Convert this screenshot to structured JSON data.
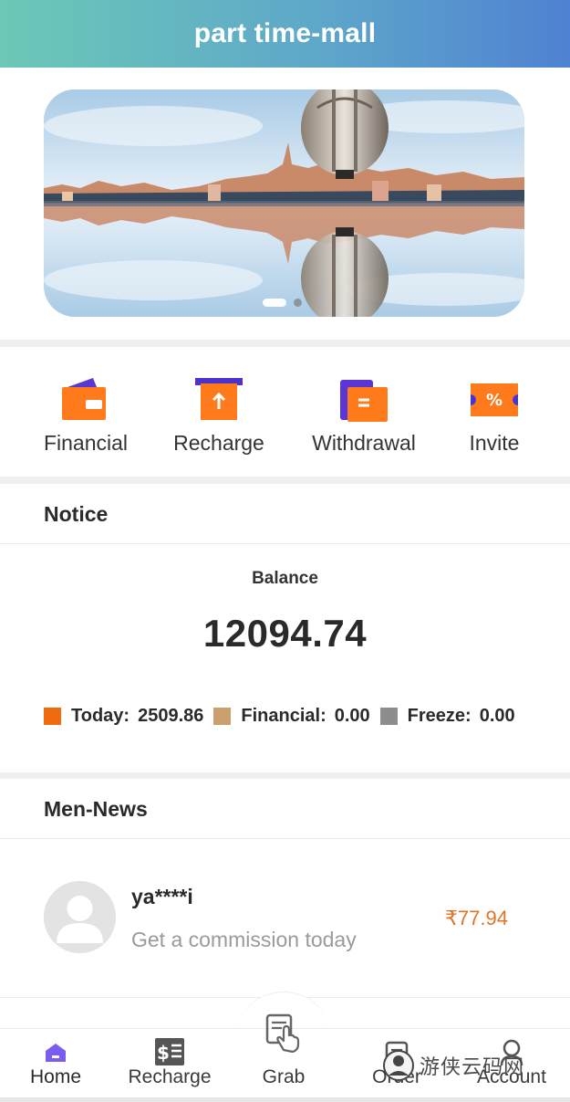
{
  "header": {
    "title": "part time-mall"
  },
  "quick_actions": [
    {
      "label": "Financial",
      "icon": "wallet-icon"
    },
    {
      "label": "Recharge",
      "icon": "recharge-icon"
    },
    {
      "label": "Withdrawal",
      "icon": "withdrawal-icon"
    },
    {
      "label": "Invite",
      "icon": "coupon-icon"
    }
  ],
  "notice": {
    "title": "Notice"
  },
  "balance": {
    "label": "Balance",
    "value": "12094.74",
    "stats": [
      {
        "label": "Today:",
        "value": "2509.86",
        "color": "#f06a10"
      },
      {
        "label": "Financial:",
        "value": "0.00",
        "color": "#c9a06e"
      },
      {
        "label": "Freeze:",
        "value": "0.00",
        "color": "#8d8d8d"
      }
    ]
  },
  "news": {
    "title": "Men-News",
    "items": [
      {
        "user": "ya****i",
        "description": "Get a commission today",
        "amount": "₹77.94"
      }
    ]
  },
  "tabbar": {
    "items": [
      {
        "label": "Home",
        "icon": "home-icon",
        "active": true
      },
      {
        "label": "Recharge",
        "icon": "dollar-receipt-icon",
        "active": false
      },
      {
        "label": "Grab",
        "icon": "hand-tap-icon",
        "active": false
      },
      {
        "label": "Order",
        "icon": "order-icon",
        "active": false
      },
      {
        "label": "Account",
        "icon": "user-icon",
        "active": false
      }
    ]
  },
  "watermark": {
    "text": "游侠云码网"
  },
  "colors": {
    "accent_orange": "#e07426",
    "header_gradient_start": "#6cc8b6",
    "header_gradient_end": "#4f82d2",
    "active_tab": "#7a5cf0"
  }
}
